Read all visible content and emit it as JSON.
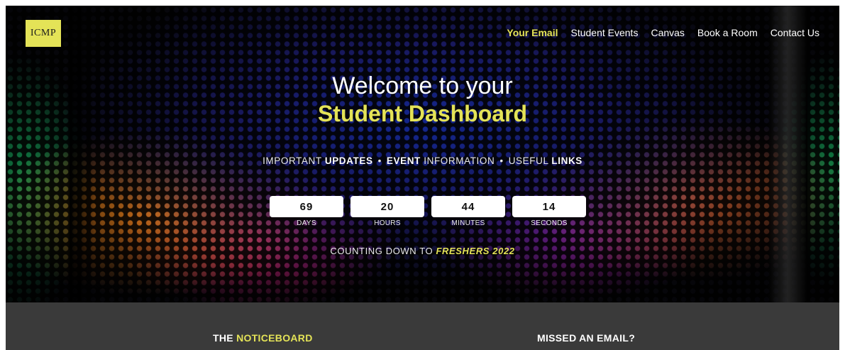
{
  "logo": {
    "text": "ICMP"
  },
  "nav": {
    "items": [
      {
        "label": "Your Email",
        "active": true
      },
      {
        "label": "Student Events",
        "active": false
      },
      {
        "label": "Canvas",
        "active": false
      },
      {
        "label": "Book a Room",
        "active": false
      },
      {
        "label": "Contact Us",
        "active": false
      }
    ]
  },
  "hero": {
    "welcome": "Welcome to your",
    "dashboard": "Student Dashboard",
    "tagline": {
      "part1_plain": "IMPORTANT ",
      "part1_bold": "UPDATES",
      "separator": "•",
      "part2_bold": "EVENT",
      "part2_plain": " INFORMATION",
      "part3_plain": "USEFUL ",
      "part3_bold": "LINKS"
    },
    "countdown": {
      "days": {
        "value": "69",
        "label": "DAYS"
      },
      "hours": {
        "value": "20",
        "label": "HOURS"
      },
      "minutes": {
        "value": "44",
        "label": "MINUTES"
      },
      "seconds": {
        "value": "14",
        "label": "SECONDS"
      }
    },
    "counting_prefix": "COUNTING DOWN TO ",
    "counting_event": "FRESHERS 2022"
  },
  "sections": {
    "noticeboard_prefix": "THE ",
    "noticeboard_highlight": "NOTICEBOARD",
    "missed_email": "MISSED AN EMAIL?"
  },
  "colors": {
    "accent": "#e4e357",
    "band": "#3a3a3a"
  }
}
